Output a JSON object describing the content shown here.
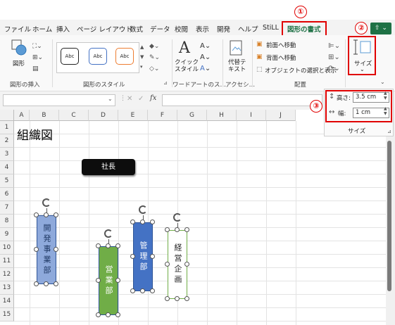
{
  "ribbon_tabs": [
    "ファイル",
    "ホーム",
    "挿入",
    "ページ レイアウト",
    "数式",
    "データ",
    "校閲",
    "表示",
    "開発",
    "ヘルプ",
    "StiLL",
    "図形の書式"
  ],
  "active_tab": "図形の書式",
  "markers": [
    "①",
    "②",
    "③"
  ],
  "groups": {
    "insert_shapes": {
      "button": "図形",
      "label": "図形の挿入"
    },
    "shape_styles": {
      "label": "図形のスタイル",
      "preset_labels": [
        "Abc",
        "Abc",
        "Abc"
      ]
    },
    "wordart": {
      "quick_style": "クイック\nスタイル",
      "label": "ワードアートのス…"
    },
    "accessibility": {
      "alt_text": "代替テ\nキスト",
      "label": "アクセシ…"
    },
    "arrange": {
      "bring_forward": "前面へ移動",
      "send_backward": "背面へ移動",
      "selection_pane": "オブジェクトの選択と表示",
      "label": "配置"
    },
    "size": {
      "button": "サイズ",
      "height_label": "高さ:",
      "height_value": "3.5 cm",
      "width_label": "幅:",
      "width_value": "1 cm",
      "label": "サイズ"
    }
  },
  "formula_bar": {
    "fx": "fx",
    "cancel": "✕",
    "confirm": "✓"
  },
  "columns": [
    "A",
    "B",
    "C",
    "D",
    "E",
    "F",
    "G",
    "H",
    "I",
    "J"
  ],
  "rows": [
    "1",
    "2",
    "3",
    "4",
    "5",
    "6",
    "7",
    "8",
    "9",
    "10",
    "11",
    "12",
    "13",
    "14",
    "15"
  ],
  "sheet": {
    "title": "組織図",
    "ceo": "社長",
    "departments": [
      {
        "text": "開発事業部",
        "color": "#8ea9db"
      },
      {
        "text": "営業部",
        "color": "#70ad47"
      },
      {
        "text": "管理部",
        "color": "#4472c4"
      },
      {
        "text": "経営企画",
        "color": "#ffffff"
      }
    ]
  },
  "colors": {
    "accent": "#1e7145",
    "highlight": "#e00000"
  }
}
